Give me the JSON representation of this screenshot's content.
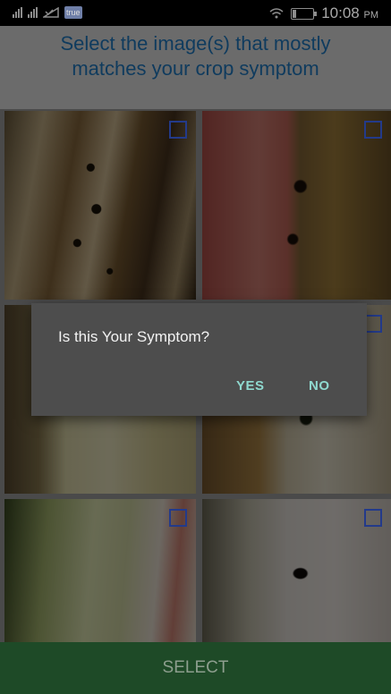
{
  "status_bar": {
    "carrier": "true",
    "time": "10:08",
    "ampm": "PM",
    "icons": [
      "signal-icon",
      "signal-icon",
      "check-signal-icon",
      "carrier-icon",
      "wifi-icon",
      "battery-icon"
    ],
    "battery_level": 0.15
  },
  "header": {
    "line1": "Select the image(s) that mostly",
    "line2": "matches your crop symptom"
  },
  "grid": {
    "tiles": [
      {
        "name": "symptom-image-1",
        "selected": false
      },
      {
        "name": "symptom-image-2",
        "selected": false
      },
      {
        "name": "symptom-image-3",
        "selected": false
      },
      {
        "name": "symptom-image-4",
        "selected": false
      },
      {
        "name": "symptom-image-5",
        "selected": false
      },
      {
        "name": "symptom-image-6",
        "selected": false
      }
    ]
  },
  "dialog": {
    "message": "Is this Your Symptom?",
    "yes_label": "YES",
    "no_label": "NO",
    "accent_color": "#8fd9cf"
  },
  "footer": {
    "select_label": "SELECT",
    "background_color": "#1e4a27"
  }
}
